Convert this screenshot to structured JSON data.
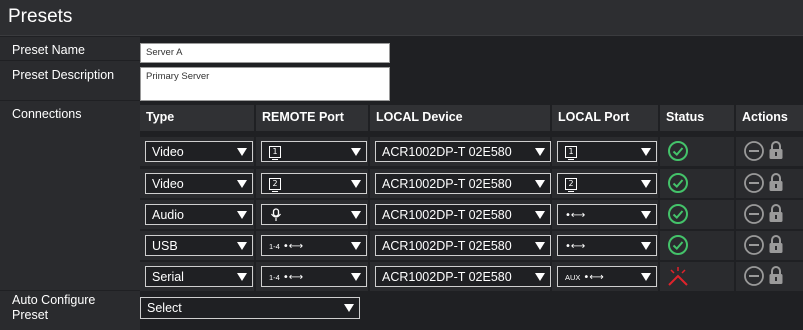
{
  "header": {
    "title": "Presets"
  },
  "form": {
    "preset_name_label": "Preset Name",
    "preset_name_value": "Server A",
    "preset_description_label": "Preset Description",
    "preset_description_value": "Primary Server",
    "connections_label": "Connections",
    "auto_configure_label_line1": "Auto Configure",
    "auto_configure_label_line2": "Preset",
    "auto_configure_value": "Select"
  },
  "table": {
    "headers": [
      "Type",
      "REMOTE Port",
      "LOCAL Device",
      "LOCAL Port",
      "Status",
      "Actions"
    ],
    "rows": [
      {
        "type": "Video",
        "remote_port": "1",
        "remote_port_icon": "monitor-port-icon",
        "local_device": "ACR1002DP-T 02E580",
        "local_port": "1",
        "local_port_icon": "monitor-port-icon",
        "status": "ok"
      },
      {
        "type": "Video",
        "remote_port": "2",
        "remote_port_icon": "monitor-port-icon",
        "local_device": "ACR1002DP-T 02E580",
        "local_port": "2",
        "local_port_icon": "monitor-port-icon",
        "status": "ok"
      },
      {
        "type": "Audio",
        "remote_port": "",
        "remote_port_icon": "microphone-icon",
        "local_device": "ACR1002DP-T 02E580",
        "local_port": "",
        "local_port_icon": "usb-icon",
        "status": "ok"
      },
      {
        "type": "USB",
        "remote_port": "1-4",
        "remote_port_icon": "usb-icon",
        "local_device": "ACR1002DP-T 02E580",
        "local_port": "",
        "local_port_icon": "usb-icon",
        "status": "ok"
      },
      {
        "type": "Serial",
        "remote_port": "1-4",
        "remote_port_icon": "usb-icon",
        "local_device": "ACR1002DP-T 02E580",
        "local_port": "AUX",
        "local_port_icon": "usb-icon",
        "status": "error"
      }
    ]
  },
  "colors": {
    "status_ok": "#44c36a",
    "status_error": "#e0232b",
    "action_icon": "#9a9a9a"
  }
}
